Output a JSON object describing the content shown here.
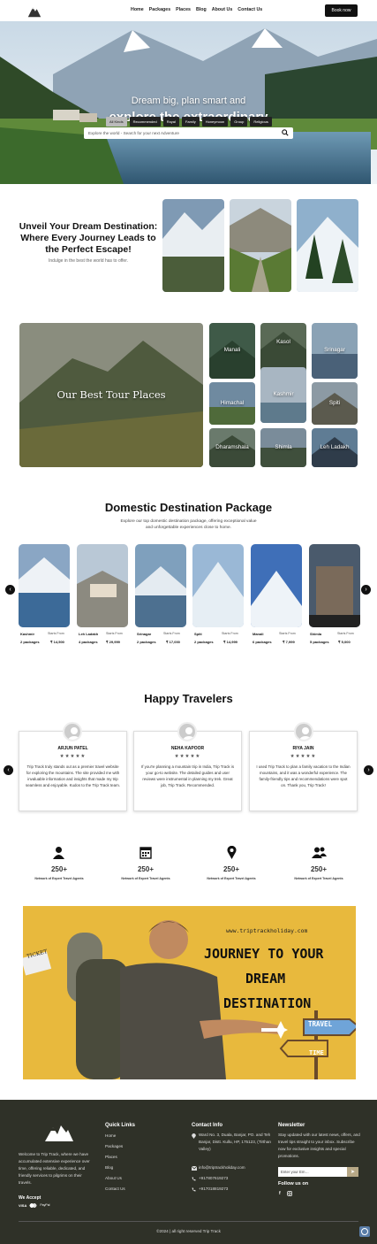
{
  "nav": {
    "items": [
      "Home",
      "Packages",
      "Places",
      "Blog",
      "About Us",
      "Contact Us"
    ],
    "cta": "Book now"
  },
  "hero": {
    "line1": "Dream big, plan smart and",
    "line2": "explore the extraordinary",
    "tabs": [
      "All Kinds",
      "Recommended",
      "Royal",
      "Family",
      "Honeymoon",
      "Group",
      "Religious"
    ],
    "search_placeholder": "Explore the world - Search for your next Adventure"
  },
  "unveil": {
    "title": "Unveil Your Dream Destination: Where Every Journey Leads to the Perfect Escape!",
    "subtitle": "Indulge in the best the world has to offer."
  },
  "tour": {
    "title": "Our Best Tour Places",
    "places": [
      "Manali",
      "Kasol",
      "Srinagar",
      "Himachal",
      "Kashmir",
      "Spiti",
      "Dharamshala",
      "Shimla",
      "Leh Ladakh"
    ]
  },
  "domestic": {
    "title": "Domestic Destination Package",
    "subtitle": "Explore our top domestic destination package, offering exceptional value and unforgettable experiences close to home.",
    "packages": [
      {
        "name": "Kashmir",
        "start": "Starts From",
        "count": "2 packages",
        "price": "₹ 14,500"
      },
      {
        "name": "Leh Ladakh",
        "start": "Starts From",
        "count": "4 packages",
        "price": "₹ 29,999"
      },
      {
        "name": "Srinagar",
        "start": "Starts From",
        "count": "2 packages",
        "price": "₹ 17,000"
      },
      {
        "name": "Spiti",
        "start": "Starts From",
        "count": "2 packages",
        "price": "₹ 14,999"
      },
      {
        "name": "Manali",
        "start": "Starts From",
        "count": "6 packages",
        "price": "₹ 7,999"
      },
      {
        "name": "Shimla",
        "start": "Starts From",
        "count": "5 packages",
        "price": "₹ 5,000"
      }
    ]
  },
  "travelers": {
    "title": "Happy Travelers",
    "stars": "★★★★★",
    "reviews": [
      {
        "name": "ARJUN PATEL",
        "text": "Trip Track truly stands out as a premier travel website for exploring the mountains. The site provided me with invaluable information and insights that made my trip seamless and enjoyable. Kudos to the Trip Track team."
      },
      {
        "name": "NEHA KAPOOR",
        "text": "If you're planning a mountain trip in India, Trip Track is your go-to website. The detailed guides and user reviews were instrumental in planning my trek. Great job, Trip Track. Recommended."
      },
      {
        "name": "RIYA JAIN",
        "text": "I used Trip Track to plan a family vacation to the Indian mountains, and it was a wonderful experience. The family-friendly tips and recommendations were spot on. Thank you, Trip Track!"
      }
    ]
  },
  "stats": [
    {
      "icon": "user-icon",
      "value": "250+",
      "label": "Network of Expert Travel Agents"
    },
    {
      "icon": "calendar-icon",
      "value": "250+",
      "label": "Network of Expert Travel Agents"
    },
    {
      "icon": "location-pin-icon",
      "value": "250+",
      "label": "Network of Expert Travel Agents"
    },
    {
      "icon": "users-icon",
      "value": "250+",
      "label": "Network of Expert Travel Agents"
    }
  ],
  "banner": {
    "url": "www.triptrackholiday.com",
    "line1": "JOURNEY TO YOUR",
    "line2": "DREAM",
    "line3": "DESTINATION",
    "sign1": "TRAVEL",
    "sign2": "TIME",
    "sign3": "TICKET"
  },
  "footer": {
    "about": "Welcome to Trip Track, where we have accumulated extensive experience over time, offering reliable, dedicated, and friendly services to pilgrims on their travels.",
    "accept": "We Accept",
    "quick_links_title": "Quick Links",
    "quick_links": [
      "Home",
      "Packages",
      "Places",
      "Blog",
      "About Us",
      "Contact Us"
    ],
    "contact_title": "Contact Info",
    "address": "Ward No. 3, Duala, Banjar, PO. and Teh Banjar, Distt. Kullu, HP, 175123, (Tirthan Valley)",
    "email": "info@triptrackholiday.com",
    "phone1": "+917807619273",
    "phone2": "+917018819273",
    "newsletter_title": "Newsletter",
    "newsletter_text": "Stay updated with our latest news, offers, and travel tips straight to your inbox. Subscribe now for exclusive insights and special promotions.",
    "email_placeholder": "Enter your Em…",
    "follow": "Follow us on",
    "copyright": "©2024 | all right reserved Trip Track"
  }
}
